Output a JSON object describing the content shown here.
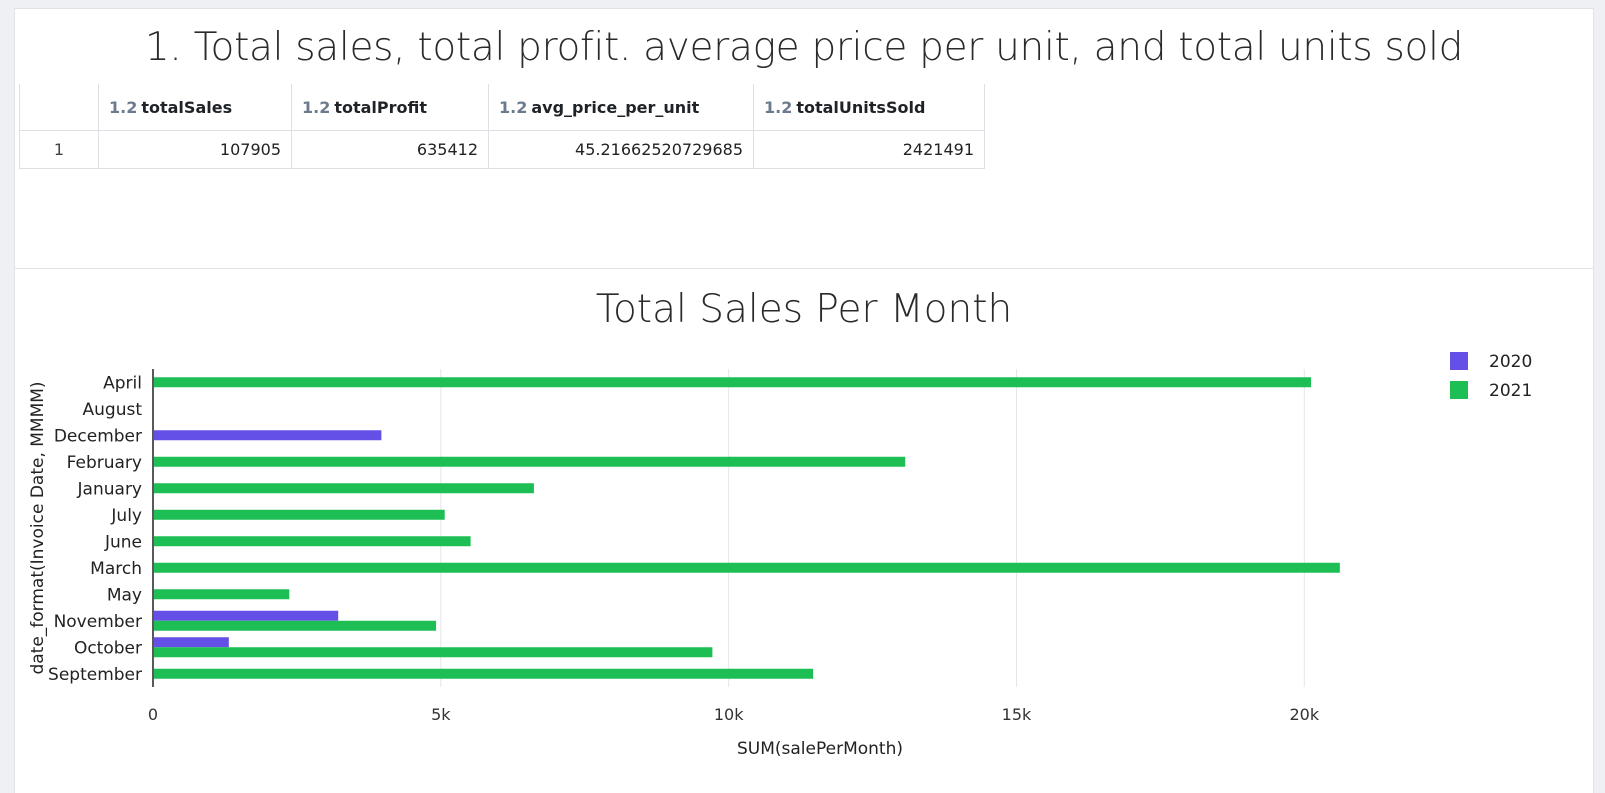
{
  "table_panel": {
    "title": "1. Total sales, total profit. average price per unit, and total units sold",
    "type_badge": "1.2",
    "columns": [
      "totalSales",
      "totalProfit",
      "avg_price_per_unit",
      "totalUnitsSold"
    ],
    "rows": [
      {
        "index": "1",
        "cells": [
          "107905",
          "635412",
          "45.21662520729685",
          "2421491"
        ]
      }
    ]
  },
  "chart_panel": {
    "title": "Total Sales Per Month"
  },
  "chart_data": {
    "type": "bar",
    "orientation": "horizontal",
    "title": "Total Sales Per Month",
    "xlabel": "SUM(salePerMonth)",
    "ylabel": "date_format(Invoice Date, MMMM)",
    "categories": [
      "April",
      "August",
      "December",
      "February",
      "January",
      "July",
      "June",
      "March",
      "May",
      "November",
      "October",
      "September"
    ],
    "xlim": [
      0,
      23000
    ],
    "x_ticks": [
      0,
      5000,
      10000,
      15000,
      20000
    ],
    "x_tick_labels": [
      "0",
      "5k",
      "10k",
      "15k",
      "20k"
    ],
    "grid": true,
    "legend_position": "top-right",
    "series": [
      {
        "name": "2020",
        "color": "#6450e6",
        "values": [
          null,
          null,
          3950,
          null,
          null,
          null,
          null,
          null,
          null,
          3200,
          1300,
          null
        ]
      },
      {
        "name": "2021",
        "color": "#1dbf55",
        "values": [
          20100,
          null,
          null,
          13050,
          6600,
          5050,
          5500,
          20600,
          2350,
          4900,
          9700,
          11450
        ]
      }
    ]
  }
}
